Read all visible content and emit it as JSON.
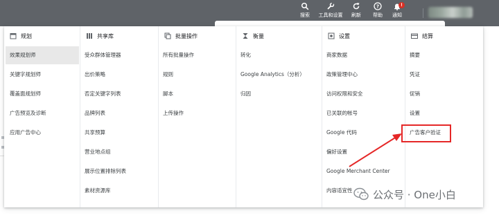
{
  "topbar": {
    "items": [
      {
        "label": "搜索",
        "icon": "search-icon"
      },
      {
        "label": "工具和设置",
        "icon": "tools-icon"
      },
      {
        "label": "刷新",
        "icon": "refresh-icon"
      },
      {
        "label": "帮助",
        "icon": "help-icon"
      },
      {
        "label": "通知",
        "icon": "bell-icon",
        "badge": "!"
      }
    ]
  },
  "menu": {
    "columns": [
      {
        "heading": "规划",
        "icon": "calendar-icon",
        "items": [
          "效果规划师",
          "关键字规划师",
          "覆盖面规划师",
          "广告预览及诊断",
          "应用广告中心"
        ]
      },
      {
        "heading": "共享库",
        "icon": "library-icon",
        "items": [
          "受众群体管理器",
          "出价策略",
          "否定关键字列表",
          "品牌列表",
          "共享预算",
          "营业地点组",
          "展示位置排除列表",
          "素材资源库"
        ]
      },
      {
        "heading": "批量操作",
        "icon": "copy-icon",
        "items": [
          "所有批量操作",
          "规则",
          "脚本",
          "上传操作"
        ]
      },
      {
        "heading": "衡量",
        "icon": "hourglass-icon",
        "items": [
          "转化",
          "Google Analytics（分析）",
          "归因"
        ]
      },
      {
        "heading": "设置",
        "icon": "settings-icon",
        "items": [
          "商家数据",
          "政策管理中心",
          "访问权限和安全",
          "已关联的帐号",
          "Google 代码",
          "偏好设置",
          "Google Merchant Center",
          "内容适宜性"
        ]
      },
      {
        "heading": "结算",
        "icon": "card-icon",
        "items": [
          "摘要",
          "凭证",
          "促销",
          "设置",
          "广告客户验证"
        ]
      }
    ]
  },
  "watermark": {
    "text": "公众号 · One小白",
    "icon": "wechat-icon"
  },
  "colors": {
    "topbar": "#5f6368",
    "highlight": "#e52727",
    "selected": "#e8e8e8"
  }
}
